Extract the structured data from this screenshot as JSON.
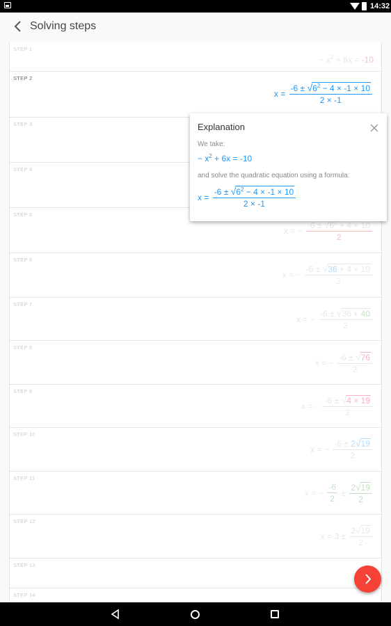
{
  "status_bar": {
    "time": "14:32"
  },
  "header": {
    "title": "Solving steps"
  },
  "steps": [
    {
      "label": "STEP 1"
    },
    {
      "label": "STEP 2"
    },
    {
      "label": "STEP 3"
    },
    {
      "label": "STEP 4"
    },
    {
      "label": "STEP 5"
    },
    {
      "label": "STEP 6"
    },
    {
      "label": "STEP 7"
    },
    {
      "label": "STEP 8"
    },
    {
      "label": "STEP 9"
    },
    {
      "label": "STEP 10"
    },
    {
      "label": "STEP 11"
    },
    {
      "label": "STEP 12"
    },
    {
      "label": "STEP 13"
    },
    {
      "label": "STEP 14"
    }
  ],
  "explanation": {
    "title": "Explanation",
    "line1": "We take:",
    "line2": "and solve the quadratic equation using a formula:"
  },
  "colors": {
    "accent": "#2196f3",
    "fab": "#f44336",
    "highlight_red": "#f44336",
    "highlight_green": "#4caf50"
  },
  "icons": {
    "back": "arrow-left-icon",
    "close": "close-icon",
    "fab": "chevron-right-icon"
  }
}
